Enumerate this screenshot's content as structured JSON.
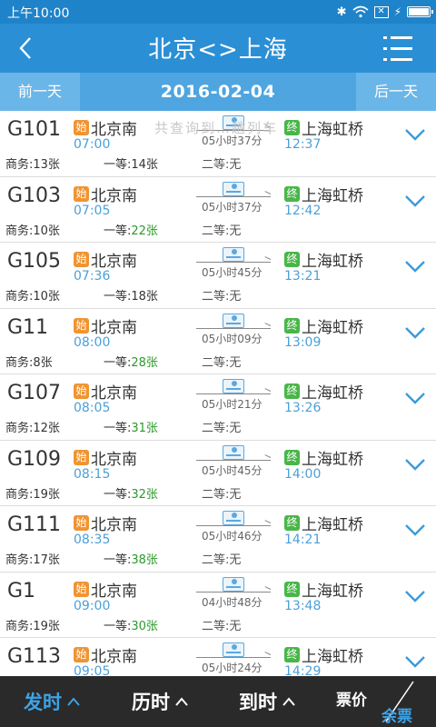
{
  "status_bar": {
    "time": "上午10:00"
  },
  "header": {
    "title": "北京<>上海"
  },
  "date_bar": {
    "prev": "前一天",
    "date": "2016-02-04",
    "next": "后一天"
  },
  "overlay_text": "共查询到…趟列车",
  "colors": {
    "primary": "#2b8fd6",
    "start_tag": "#f09432",
    "end_tag": "#49b649",
    "time": "#4ba0d8",
    "available": "#2a9a2a"
  },
  "trains": [
    {
      "no": "G101",
      "start_tag": "始",
      "from": "北京南",
      "dep": "07:00",
      "duration": "05小时37分",
      "end_tag": "终",
      "to": "上海虹桥",
      "arr": "12:37",
      "business": "商务:13张",
      "first_label": "一等:",
      "first_count": "14张",
      "first_available": false,
      "second": "二等:无"
    },
    {
      "no": "G103",
      "start_tag": "始",
      "from": "北京南",
      "dep": "07:05",
      "duration": "05小时37分",
      "end_tag": "终",
      "to": "上海虹桥",
      "arr": "12:42",
      "business": "商务:10张",
      "first_label": "一等:",
      "first_count": "22张",
      "first_available": true,
      "second": "二等:无"
    },
    {
      "no": "G105",
      "start_tag": "始",
      "from": "北京南",
      "dep": "07:36",
      "duration": "05小时45分",
      "end_tag": "终",
      "to": "上海虹桥",
      "arr": "13:21",
      "business": "商务:10张",
      "first_label": "一等:",
      "first_count": "18张",
      "first_available": false,
      "second": "二等:无"
    },
    {
      "no": "G11",
      "start_tag": "始",
      "from": "北京南",
      "dep": "08:00",
      "duration": "05小时09分",
      "end_tag": "终",
      "to": "上海虹桥",
      "arr": "13:09",
      "business": "商务:8张",
      "first_label": "一等:",
      "first_count": "28张",
      "first_available": true,
      "second": "二等:无"
    },
    {
      "no": "G107",
      "start_tag": "始",
      "from": "北京南",
      "dep": "08:05",
      "duration": "05小时21分",
      "end_tag": "终",
      "to": "上海虹桥",
      "arr": "13:26",
      "business": "商务:12张",
      "first_label": "一等:",
      "first_count": "31张",
      "first_available": true,
      "second": "二等:无"
    },
    {
      "no": "G109",
      "start_tag": "始",
      "from": "北京南",
      "dep": "08:15",
      "duration": "05小时45分",
      "end_tag": "终",
      "to": "上海虹桥",
      "arr": "14:00",
      "business": "商务:19张",
      "first_label": "一等:",
      "first_count": "32张",
      "first_available": true,
      "second": "二等:无"
    },
    {
      "no": "G111",
      "start_tag": "始",
      "from": "北京南",
      "dep": "08:35",
      "duration": "05小时46分",
      "end_tag": "终",
      "to": "上海虹桥",
      "arr": "14:21",
      "business": "商务:17张",
      "first_label": "一等:",
      "first_count": "38张",
      "first_available": true,
      "second": "二等:无"
    },
    {
      "no": "G1",
      "start_tag": "始",
      "from": "北京南",
      "dep": "09:00",
      "duration": "04小时48分",
      "end_tag": "终",
      "to": "上海虹桥",
      "arr": "13:48",
      "business": "商务:19张",
      "first_label": "一等:",
      "first_count": "30张",
      "first_available": true,
      "second": "二等:无"
    },
    {
      "no": "G113",
      "start_tag": "始",
      "from": "北京南",
      "dep": "09:05",
      "duration": "05小时24分",
      "end_tag": "终",
      "to": "上海虹桥",
      "arr": "14:29",
      "business": "",
      "first_label": "",
      "first_count": "",
      "first_available": false,
      "second": ""
    }
  ],
  "bottom_bar": {
    "depart": "发时",
    "duration": "历时",
    "arrive": "到时",
    "price": "票价",
    "remain": "余票"
  }
}
